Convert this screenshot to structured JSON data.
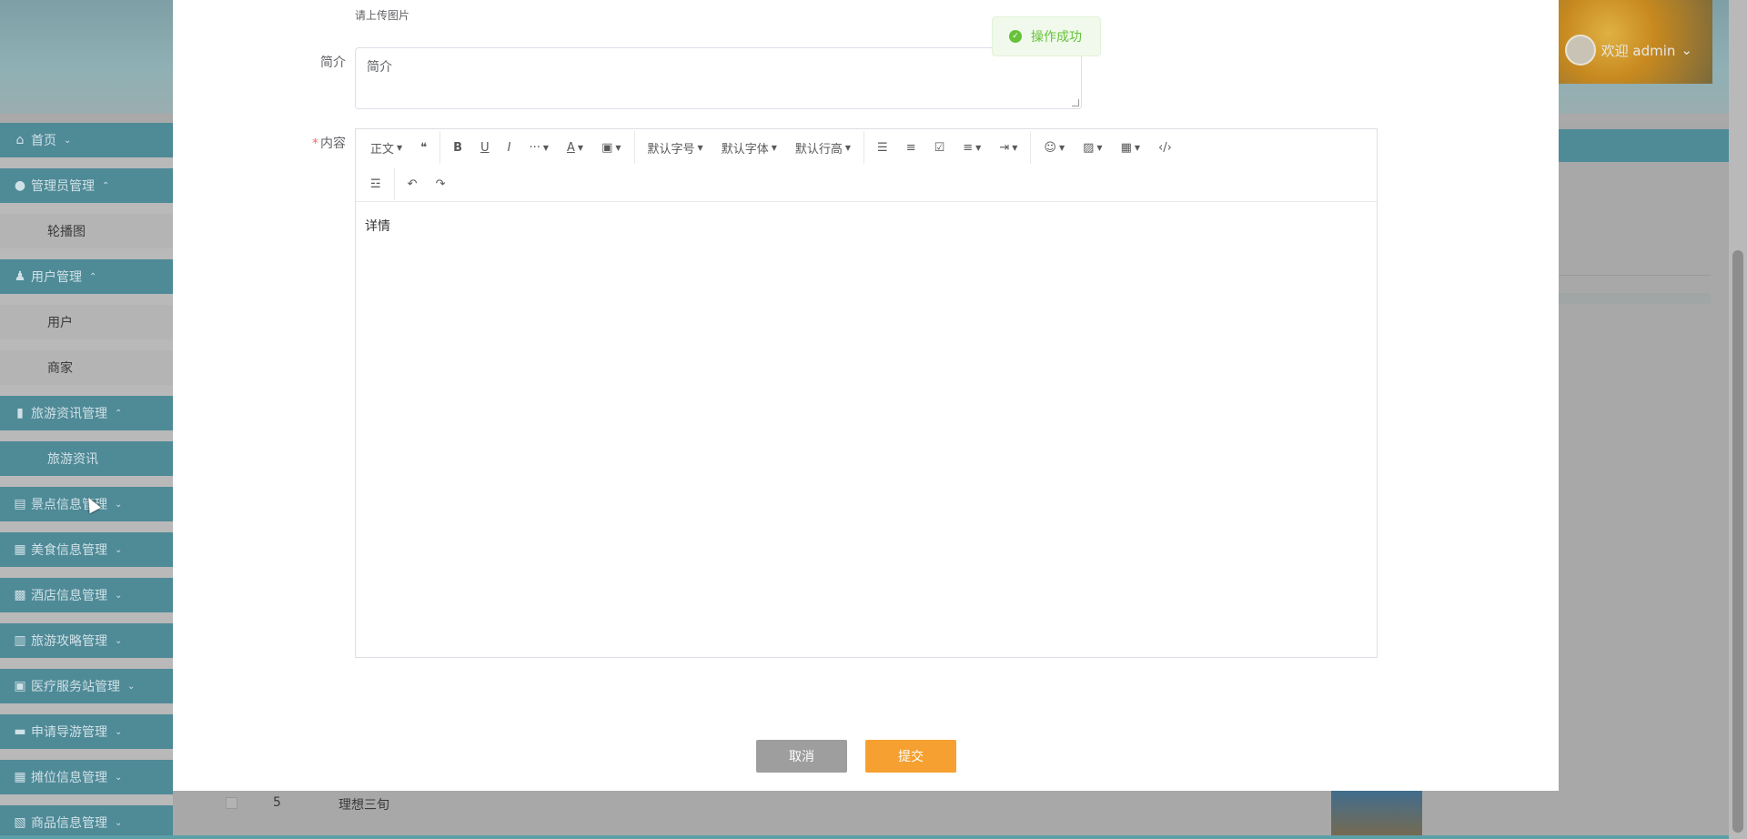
{
  "header": {
    "welcome": "欢迎 admin",
    "welcome_chevron": "⌄"
  },
  "sidebar": {
    "items": [
      {
        "label": "首页",
        "icon": "home-icon",
        "kind": "group"
      },
      {
        "label": "管理员管理",
        "icon": "admin-icon",
        "kind": "group"
      },
      {
        "label": "轮播图",
        "kind": "sub"
      },
      {
        "label": "用户管理",
        "icon": "user-icon",
        "kind": "group"
      },
      {
        "label": "用户",
        "kind": "sub"
      },
      {
        "label": "商家",
        "kind": "sub"
      },
      {
        "label": "旅游资讯管理",
        "icon": "book-icon",
        "kind": "group"
      },
      {
        "label": "旅游资讯",
        "kind": "sub",
        "active": true
      },
      {
        "label": "景点信息管理",
        "icon": "store-icon",
        "kind": "group"
      },
      {
        "label": "美食信息管理",
        "icon": "grid-icon",
        "kind": "group"
      },
      {
        "label": "酒店信息管理",
        "icon": "car-icon",
        "kind": "group"
      },
      {
        "label": "旅游攻略管理",
        "icon": "building-icon",
        "kind": "group"
      },
      {
        "label": "医疗服务站管理",
        "icon": "gift-icon",
        "kind": "group"
      },
      {
        "label": "申请导游管理",
        "icon": "briefcase-icon",
        "kind": "group"
      },
      {
        "label": "摊位信息管理",
        "icon": "tiles-icon",
        "kind": "group"
      },
      {
        "label": "商品信息管理",
        "icon": "goods-icon",
        "kind": "group"
      }
    ]
  },
  "background_table": {
    "row_number": "5",
    "row_title": "理想三旬"
  },
  "dialog": {
    "upload_hint": "请上传图片",
    "summary_label": "简介",
    "summary_value": "简介",
    "content_label": "内容",
    "content_required_mark": "*",
    "editor_body": "详情",
    "toolbar": {
      "paragraph": "正文",
      "font_size": "默认字号",
      "font_family": "默认字体",
      "line_height": "默认行高"
    },
    "cancel_label": "取消",
    "submit_label": "提交"
  },
  "toast": {
    "message": "操作成功"
  },
  "colors": {
    "sidebar_active": "#4f8a97",
    "submit": "#f5a030",
    "cancel": "#9e9e9e",
    "success": "#67c23a"
  }
}
